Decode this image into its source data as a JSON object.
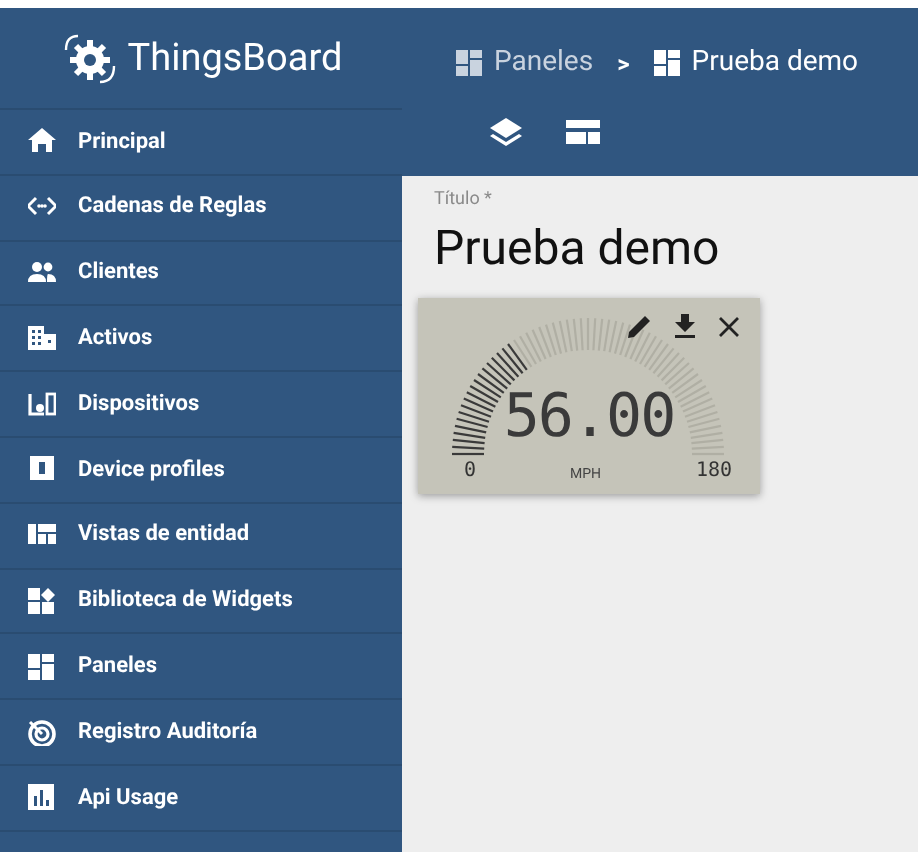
{
  "sidebar": {
    "logo": "ThingsBoard",
    "items": [
      {
        "label": "Principal"
      },
      {
        "label": "Cadenas de Reglas"
      },
      {
        "label": "Clientes"
      },
      {
        "label": "Activos"
      },
      {
        "label": "Dispositivos"
      },
      {
        "label": "Device profiles"
      },
      {
        "label": "Vistas de entidad"
      },
      {
        "label": "Biblioteca de Widgets"
      },
      {
        "label": "Paneles"
      },
      {
        "label": "Registro Auditoría"
      },
      {
        "label": "Api Usage"
      }
    ]
  },
  "breadcrumb": [
    {
      "label": "Paneles",
      "current": false
    },
    {
      "label": "Prueba demo",
      "current": true
    }
  ],
  "breadcrumb_separator": ">",
  "title_field": {
    "label": "Título *",
    "value": "Prueba demo"
  },
  "gauge": {
    "value": "56.00",
    "min": "0",
    "max": "180",
    "unit": "MPH"
  }
}
